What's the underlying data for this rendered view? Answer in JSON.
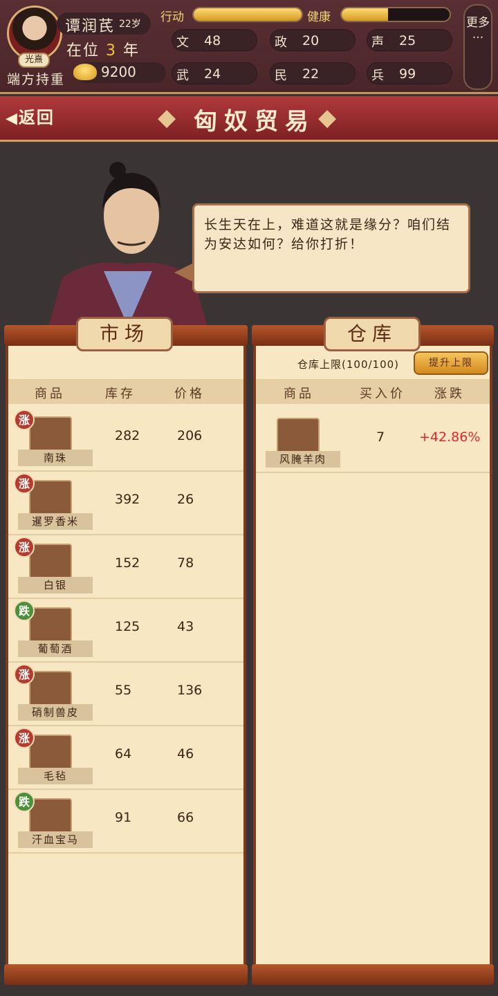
{
  "player": {
    "name": "谭润芪",
    "age": "22岁",
    "reign_prefix": "在位",
    "reign_years": "3",
    "reign_suffix": "年",
    "era_badge": "光熹",
    "title": "端方持重",
    "gold": "9200"
  },
  "bars": {
    "action_label": "行动",
    "action_level": 1.0,
    "health_label": "健康",
    "health_level": 0.43
  },
  "stats": [
    {
      "label": "文",
      "value": "48"
    },
    {
      "label": "政",
      "value": "20"
    },
    {
      "label": "声",
      "value": "25"
    },
    {
      "label": "武",
      "value": "24"
    },
    {
      "label": "民",
      "value": "22"
    },
    {
      "label": "兵",
      "value": "99"
    }
  ],
  "more_label": "更多···",
  "header": {
    "back_label": "返回",
    "back_icon": "chevron-left-icon",
    "title": "匈奴贸易"
  },
  "dialog": {
    "text": "长生天在上，难道这就是缘分？咱们结为安达如何？给你打折！"
  },
  "market": {
    "title": "市场",
    "columns": [
      "商品",
      "库存",
      "价格"
    ],
    "items": [
      {
        "name": "南珠",
        "trend": "涨",
        "trend_type": "up",
        "stock": "282",
        "price": "206",
        "icon": "pearl-icon"
      },
      {
        "name": "暹罗香米",
        "trend": "涨",
        "trend_type": "up",
        "stock": "392",
        "price": "26",
        "icon": "rice-icon"
      },
      {
        "name": "白银",
        "trend": "涨",
        "trend_type": "up",
        "stock": "152",
        "price": "78",
        "icon": "silver-icon"
      },
      {
        "name": "葡萄酒",
        "trend": "跌",
        "trend_type": "down",
        "stock": "125",
        "price": "43",
        "icon": "wine-gourd-icon"
      },
      {
        "name": "硝制兽皮",
        "trend": "涨",
        "trend_type": "up",
        "stock": "55",
        "price": "136",
        "icon": "hide-icon"
      },
      {
        "name": "毛毡",
        "trend": "涨",
        "trend_type": "up",
        "stock": "64",
        "price": "46",
        "icon": "felt-icon"
      },
      {
        "name": "汗血宝马",
        "trend": "跌",
        "trend_type": "down",
        "stock": "91",
        "price": "66",
        "icon": "horse-icon"
      }
    ]
  },
  "warehouse": {
    "title": "仓库",
    "capacity_label": "仓库上限(100/100)",
    "upgrade_label": "提升上限",
    "columns": [
      "商品",
      "买入价",
      "涨跌"
    ],
    "items": [
      {
        "name": "风腌羊肉",
        "buy_price": "7",
        "change": "+42.86%",
        "icon": "cured-mutton-icon"
      }
    ]
  },
  "colors": {
    "up": "#b63a2e",
    "down": "#4e8f3a",
    "gain": "#e8262a"
  }
}
